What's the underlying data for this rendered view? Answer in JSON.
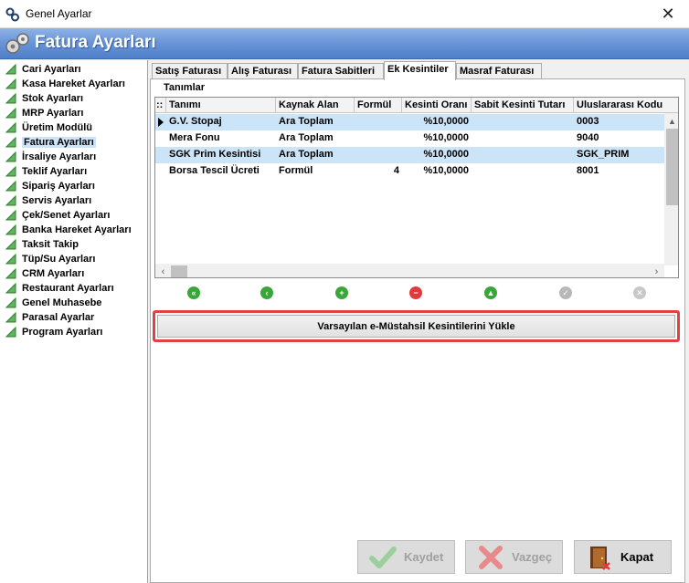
{
  "window": {
    "title": "Genel Ayarlar",
    "close_glyph": "✕"
  },
  "header": {
    "title": "Fatura Ayarları",
    "icon": "gears-icon"
  },
  "sidebar": {
    "items": [
      {
        "label": "Cari Ayarları"
      },
      {
        "label": "Kasa Hareket Ayarları"
      },
      {
        "label": "Stok Ayarları"
      },
      {
        "label": "MRP Ayarları"
      },
      {
        "label": "Üretim Modülü"
      },
      {
        "label": "Fatura Ayarları",
        "active": true
      },
      {
        "label": "İrsaliye Ayarları"
      },
      {
        "label": "Teklif Ayarları"
      },
      {
        "label": "Sipariş Ayarları"
      },
      {
        "label": "Servis Ayarları"
      },
      {
        "label": "Çek/Senet Ayarları"
      },
      {
        "label": "Banka Hareket Ayarları"
      },
      {
        "label": "Taksit Takip"
      },
      {
        "label": "Tüp/Su Ayarları"
      },
      {
        "label": "CRM Ayarları"
      },
      {
        "label": "Restaurant Ayarları"
      },
      {
        "label": "Genel Muhasebe"
      },
      {
        "label": "Parasal Ayarlar"
      },
      {
        "label": "Program Ayarları"
      }
    ]
  },
  "tabs": [
    {
      "label": "Satış Faturası"
    },
    {
      "label": "Alış Faturası"
    },
    {
      "label": "Fatura Sabitleri"
    },
    {
      "label": "Ek Kesintiler",
      "active": true
    },
    {
      "label": "Masraf Faturası"
    }
  ],
  "group": {
    "label": "Tanımlar"
  },
  "grid": {
    "corner": "::",
    "columns": [
      "Tanımı",
      "Kaynak Alan",
      "Formül",
      "Kesinti Oranı",
      "Sabit Kesinti Tutarı",
      "Uluslararası Kodu"
    ],
    "rows": [
      {
        "tanimi": "G.V. Stopaj",
        "kaynak": "Ara Toplam",
        "formul": "",
        "oran": "%10,0000",
        "sabit": "",
        "kod": "0003",
        "selected": true,
        "current": true
      },
      {
        "tanimi": "Mera Fonu",
        "kaynak": "Ara Toplam",
        "formul": "",
        "oran": "%10,0000",
        "sabit": "",
        "kod": "9040"
      },
      {
        "tanimi": "SGK Prim Kesintisi",
        "kaynak": "Ara Toplam",
        "formul": "",
        "oran": "%10,0000",
        "sabit": "",
        "kod": "SGK_PRIM",
        "selected": true
      },
      {
        "tanimi": "Borsa Tescil Ücreti",
        "kaynak": "Formül",
        "formul": "4",
        "oran": "%10,0000",
        "sabit": "",
        "kod": "8001"
      }
    ]
  },
  "navigator": {
    "buttons": [
      {
        "name": "first-record-icon",
        "glyph": "«",
        "color": "#3aa63a"
      },
      {
        "name": "prev-record-icon",
        "glyph": "‹",
        "color": "#3aa63a"
      },
      {
        "name": "add-record-icon",
        "glyph": "+",
        "color": "#3aa63a"
      },
      {
        "name": "delete-record-icon",
        "glyph": "−",
        "color": "#e03b3b"
      },
      {
        "name": "edit-record-icon",
        "glyph": "▲",
        "color": "#3aa63a"
      },
      {
        "name": "post-record-icon",
        "glyph": "✓",
        "color": "#b8b8b8"
      },
      {
        "name": "cancel-record-icon",
        "glyph": "✕",
        "color": "#c8c8c8"
      }
    ]
  },
  "load_button": {
    "label": "Varsayılan e-Müstahsil Kesintilerini Yükle"
  },
  "buttons": {
    "save": {
      "label": "Kaydet",
      "disabled": true
    },
    "cancel": {
      "label": "Vazgeç",
      "disabled": true
    },
    "close": {
      "label": "Kapat",
      "disabled": false
    }
  },
  "colors": {
    "header_blue": "#4f7fc9",
    "selection": "#cce4f7",
    "highlight_red": "#e24141"
  }
}
